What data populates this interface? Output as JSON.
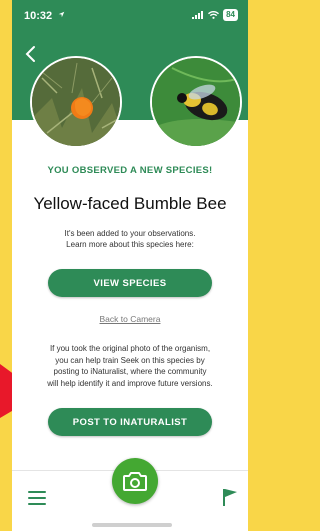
{
  "status_bar": {
    "time": "10:32",
    "battery": "84"
  },
  "header": {
    "back_icon": "chevron-left-icon",
    "brand_color": "#2e8b57"
  },
  "observation": {
    "headline": "YOU OBSERVED A NEW SPECIES!",
    "species_name": "Yellow-faced Bumble Bee",
    "message_line1": "It's been added to your observations.",
    "message_line2": "Learn more about this species here:"
  },
  "actions": {
    "view_species_label": "VIEW SPECIES",
    "back_to_camera_label": "Back to Camera",
    "info_line1": "If you took the original photo of the organism,",
    "info_line2": "you can help train Seek on this species by",
    "info_line3": "posting to iNaturalist, where the community",
    "info_line4": "will help identify it and improve future versions.",
    "post_label": "POST TO INATURALIST"
  },
  "bottom_nav": {
    "menu_icon": "menu-icon",
    "camera_icon": "camera-icon",
    "flag_icon": "flag-icon",
    "camera_color": "#44a832"
  }
}
